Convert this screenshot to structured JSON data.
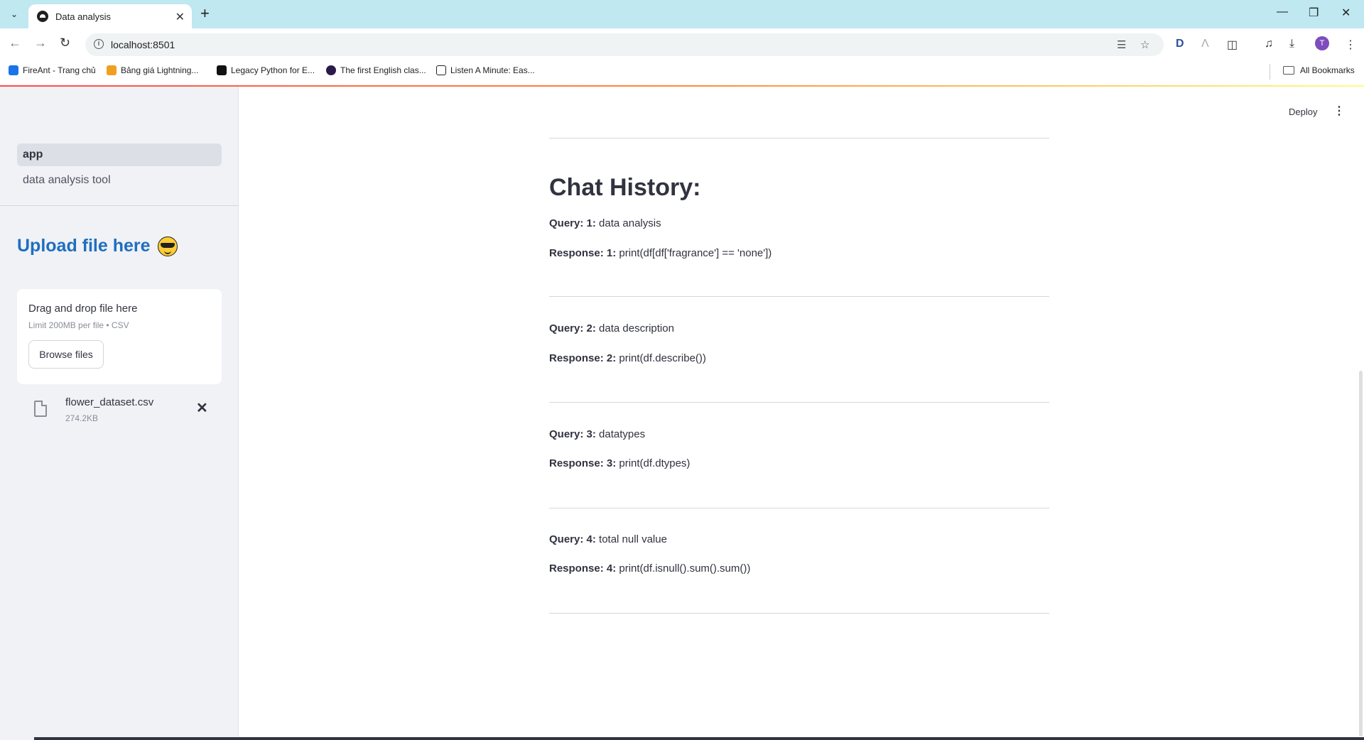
{
  "browser": {
    "tab_title": "Data analysis",
    "url": "localhost:8501",
    "profile_initial": "T",
    "all_bookmarks_label": "All Bookmarks",
    "bookmarks": [
      {
        "label": "FireAnt - Trang chủ",
        "color": "#1a73e8"
      },
      {
        "label": "Bảng giá Lightning...",
        "color": "#f0a020"
      },
      {
        "label": "Legacy Python for E...",
        "color": "#111111"
      },
      {
        "label": "The first English clas...",
        "color": "#2a1a4a"
      },
      {
        "label": "Listen A Minute: Eas...",
        "color": "#222222"
      }
    ]
  },
  "sidebar": {
    "nav": [
      {
        "label": "app",
        "active": true
      },
      {
        "label": "data analysis tool",
        "active": false
      }
    ],
    "upload_title": "Upload file here",
    "dropzone": {
      "title": "Drag and drop file here",
      "subtitle": "Limit 200MB per file • CSV",
      "button": "Browse files"
    },
    "file": {
      "name": "flower_dataset.csv",
      "size": "274.2KB"
    }
  },
  "header": {
    "deploy_label": "Deploy"
  },
  "main": {
    "heading": "Chat History:",
    "entries": [
      {
        "q_label": "Query: 1:",
        "q_text": " data analysis",
        "r_label": "Response: 1:",
        "r_text": " print(df[df['fragrance'] == 'none'])"
      },
      {
        "q_label": "Query: 2:",
        "q_text": " data description",
        "r_label": "Response: 2:",
        "r_text": " print(df.describe())"
      },
      {
        "q_label": "Query: 3:",
        "q_text": " datatypes",
        "r_label": "Response: 3:",
        "r_text": " print(df.dtypes)"
      },
      {
        "q_label": "Query: 4:",
        "q_text": " total null value",
        "r_label": "Response: 4:",
        "r_text": " print(df.isnull().sum().sum())"
      }
    ]
  }
}
